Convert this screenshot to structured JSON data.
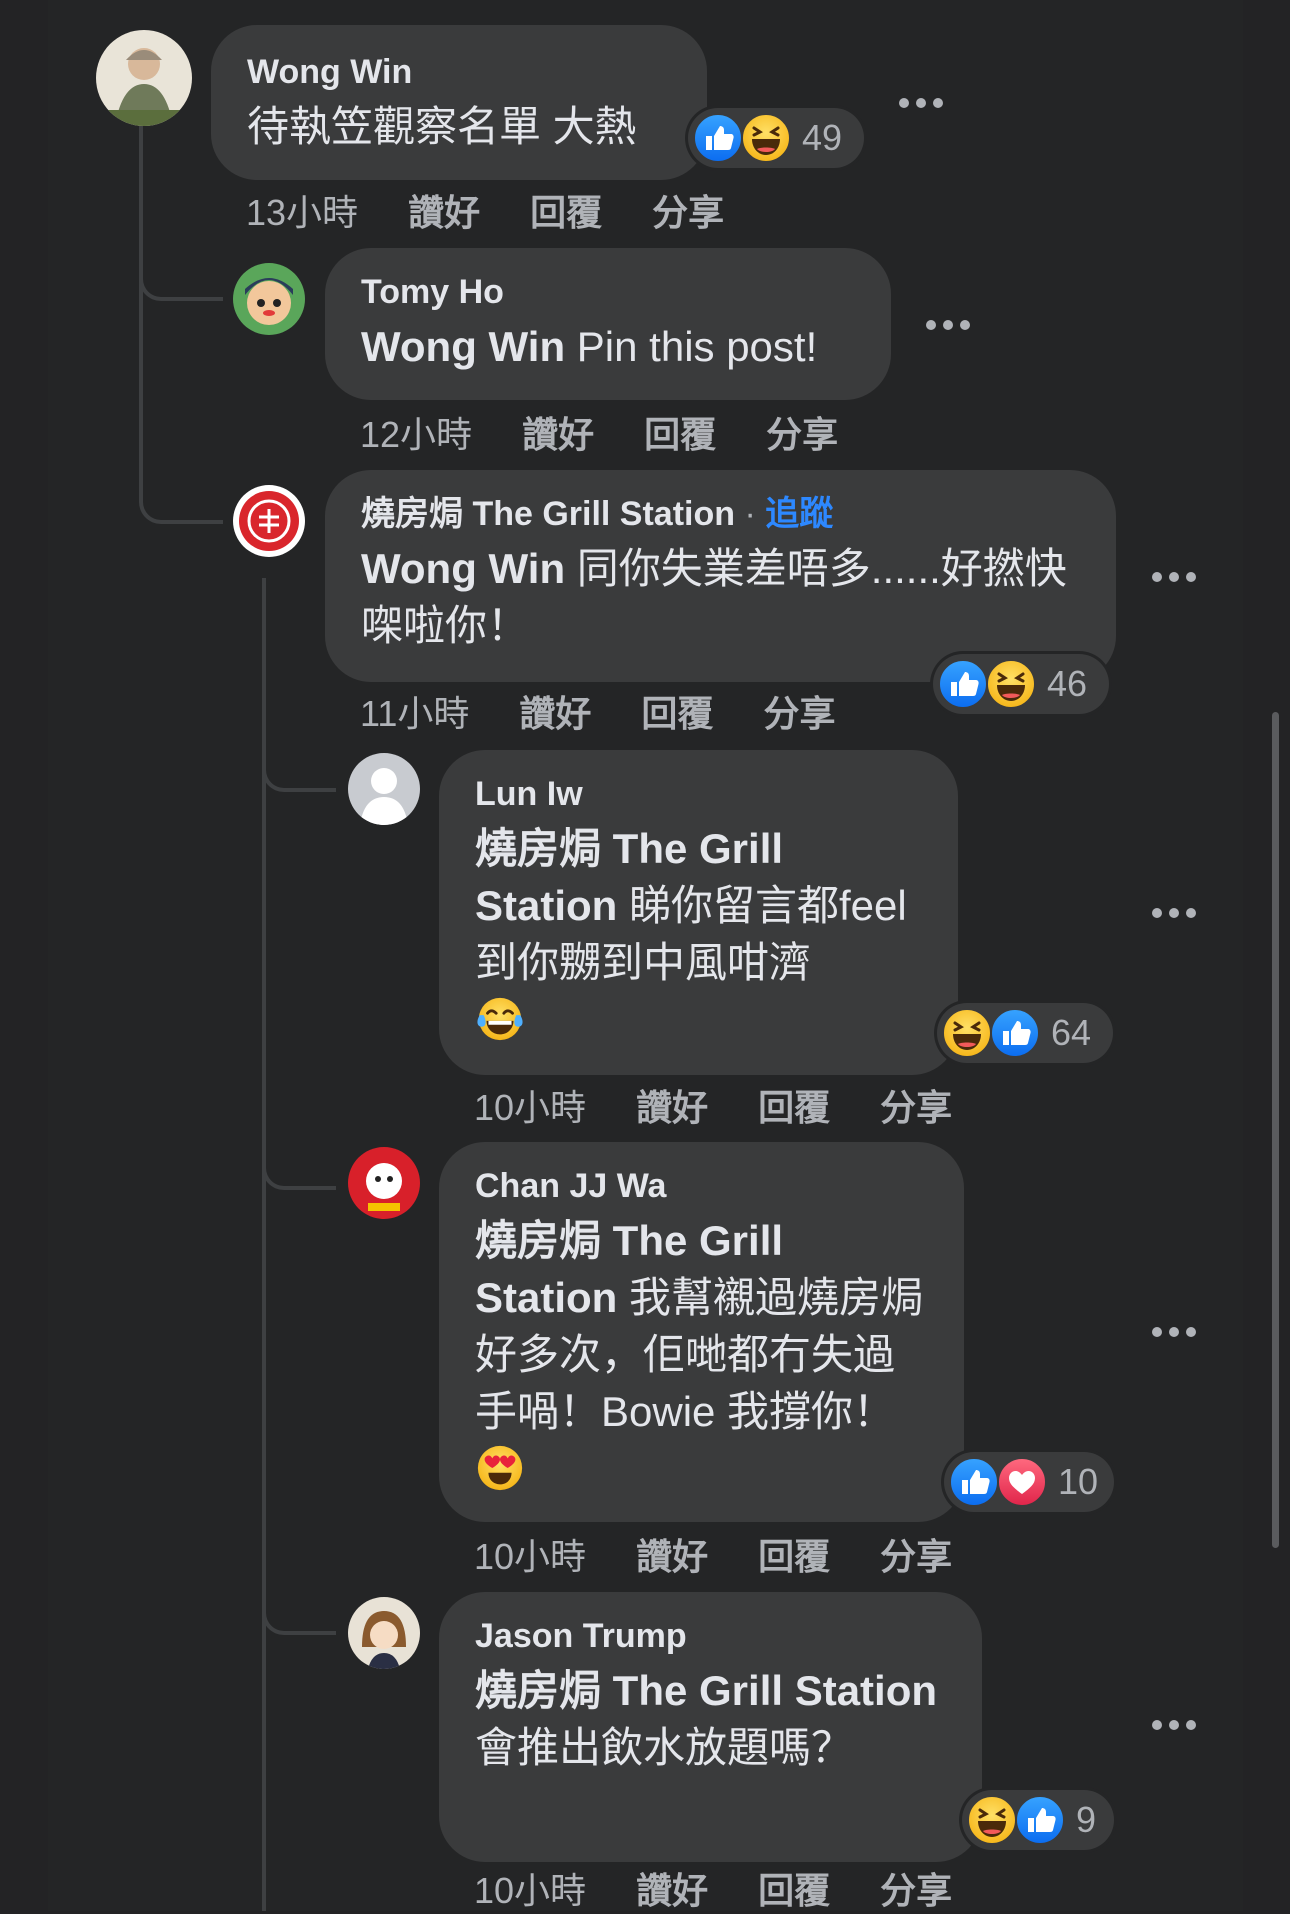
{
  "comments": [
    {
      "author": "Wong Win",
      "text": "待執笠觀察名單 大熱",
      "time": "13小時",
      "like": "讚好",
      "reply": "回覆",
      "share": "分享",
      "reaction_icons": [
        "like-icon",
        "laughing-face-icon"
      ],
      "reaction_count": "49"
    },
    {
      "author": "Tomy Ho",
      "mention": "Wong Win",
      "text": " Pin this post!",
      "time": "12小時",
      "like": "讚好",
      "reply": "回覆",
      "share": "分享"
    },
    {
      "author": "燒房焗 The Grill Station",
      "separator": " · ",
      "follow": "追蹤",
      "mention": "Wong Win",
      "text": " 同你失業差唔多......好撚快㗎啦你！",
      "time": "11小時",
      "like": "讚好",
      "reply": "回覆",
      "share": "分享",
      "reaction_icons": [
        "like-icon",
        "laughing-face-icon"
      ],
      "reaction_count": "46"
    },
    {
      "author": "Lun Iw",
      "mention": "燒房焗 The Grill Station",
      "text": " 睇你留言都feel到你嬲到中風咁濟",
      "emoji": "tears-of-joy-icon",
      "time": "10小時",
      "like": "讚好",
      "reply": "回覆",
      "share": "分享",
      "reaction_icons": [
        "laughing-face-icon",
        "like-icon"
      ],
      "reaction_count": "64"
    },
    {
      "author": "Chan JJ Wa",
      "mention": "燒房焗 The Grill Station",
      "text": " 我幫襯過燒房焗好多次，佢哋都冇失過手喎！Bowie 我撐你！",
      "emoji": "heart-eyes-icon",
      "time": "10小時",
      "like": "讚好",
      "reply": "回覆",
      "share": "分享",
      "reaction_icons": [
        "like-icon",
        "love-icon"
      ],
      "reaction_count": "10"
    },
    {
      "author": "Jason Trump",
      "mention": "燒房焗 The Grill Station",
      "text": " 會推出飲水放題嗎？",
      "time": "10小時",
      "like": "讚好",
      "reply": "回覆",
      "share": "分享",
      "reaction_icons": [
        "laughing-face-icon",
        "like-icon"
      ],
      "reaction_count": "9"
    }
  ],
  "colors": {
    "background": "#242526",
    "bubble": "#3a3b3c",
    "text": "#e4e6eb",
    "secondary": "#b0b3b8",
    "link": "#2d88ff",
    "like": "#1877f2",
    "love": "#f33e58"
  }
}
